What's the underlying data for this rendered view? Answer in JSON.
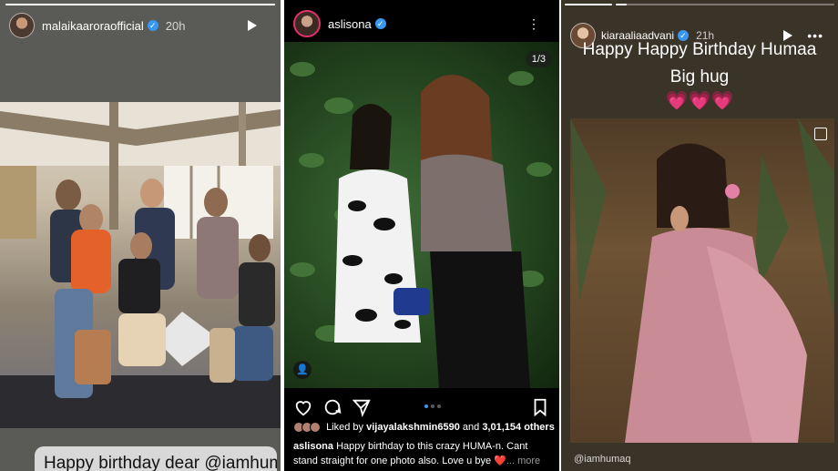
{
  "panel1": {
    "username": "malaikaaroraofficial",
    "time": "20h",
    "caption": "Happy birthday dear @iamhumaq"
  },
  "panel2": {
    "username": "aslisona",
    "more_icon": "more-vertical-icon",
    "counter": "1/3",
    "liked_by_prefix": "Liked by ",
    "liked_by_user": "vijayalakshmin6590",
    "liked_by_mid": " and ",
    "likes_count": "3,01,154",
    "liked_by_suffix": " others",
    "caption_user": "aslisona",
    "caption_text": " Happy birthday to this crazy HUMA-n. Cant stand straight for one photo also. Love u bye ❤️",
    "caption_more": "... more",
    "icons": [
      "heart-icon",
      "comment-icon",
      "share-icon",
      "bookmark-icon"
    ],
    "pager": {
      "total": 3,
      "active": 0
    }
  },
  "panel3": {
    "username": "kiaraaliaadvani",
    "time": "21h",
    "line1": "Happy Happy Birthday Humaa",
    "line2": "Big hug",
    "emojis": "💗💗💗",
    "mention": "@iamhumaq"
  },
  "colors": {
    "verified": "#3897f0",
    "link": "#3897f0"
  }
}
